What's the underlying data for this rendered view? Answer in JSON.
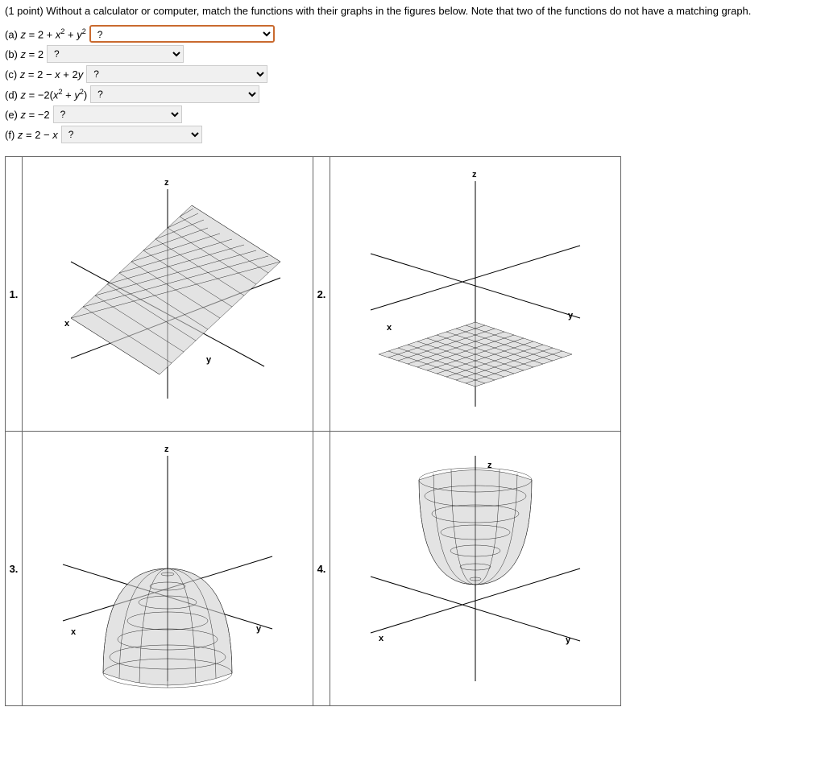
{
  "question": "(1 point) Without a calculator or computer, match the functions with their graphs in the figures below. Note that two of the functions do not have a matching graph.",
  "items": {
    "a": {
      "label_html": "(a) <i>z</i> = 2 + <i>x</i><sup>2</sup> + <i>y</i><sup>2</sup>",
      "value": "?"
    },
    "b": {
      "label_html": "(b) <i>z</i> = 2",
      "value": "?"
    },
    "c": {
      "label_html": "(c) <i>z</i> = 2 − <i>x</i> + 2<i>y</i>",
      "value": "?"
    },
    "d": {
      "label_html": "(d) <i>z</i> = −2(<i>x</i><sup>2</sup> + <i>y</i><sup>2</sup>)",
      "value": "?"
    },
    "e": {
      "label_html": "(e) <i>z</i> = −2",
      "value": "?"
    },
    "f": {
      "label_html": "(f) <i>z</i> = 2 − <i>x</i>",
      "value": "?"
    }
  },
  "figures": {
    "1": "1.",
    "2": "2.",
    "3": "3.",
    "4": "4."
  },
  "axis_labels": {
    "x": "x",
    "y": "y",
    "z": "z"
  }
}
